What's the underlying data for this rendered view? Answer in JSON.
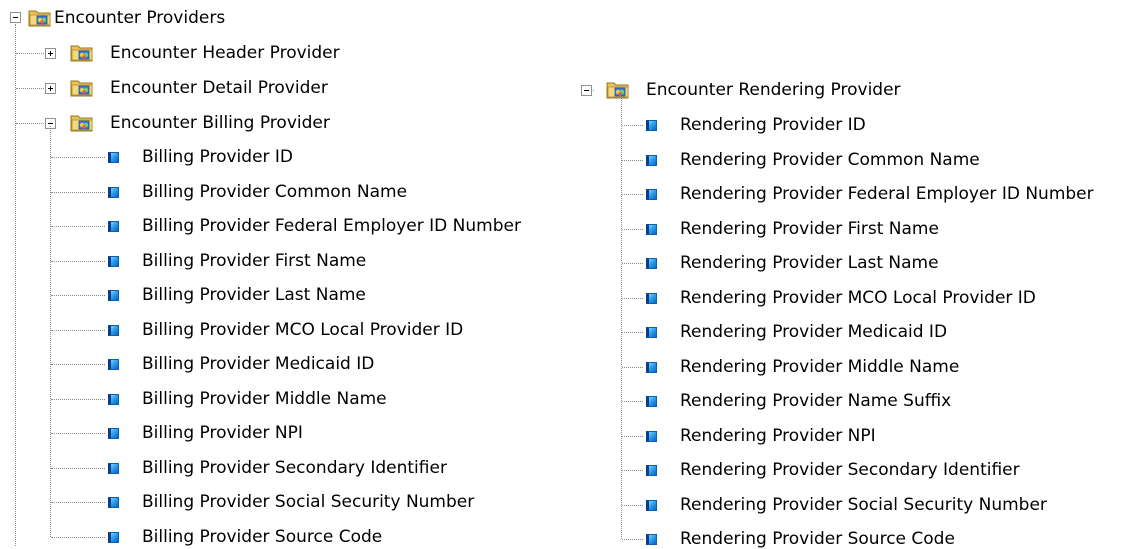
{
  "tree": {
    "root_label": "Encounter Providers",
    "left_nodes": [
      {
        "label": "Encounter Header Provider",
        "state": "collapsed"
      },
      {
        "label": "Encounter Detail Provider",
        "state": "collapsed"
      },
      {
        "label": "Encounter Billing Provider",
        "state": "expanded"
      }
    ],
    "billing_children": [
      "Billing Provider ID",
      "Billing Provider Common Name",
      "Billing Provider Federal Employer ID Number",
      "Billing Provider First Name",
      "Billing Provider Last Name",
      "Billing Provider MCO Local Provider ID",
      "Billing Provider Medicaid ID",
      "Billing Provider Middle Name",
      "Billing Provider NPI",
      "Billing Provider Secondary Identifier",
      "Billing Provider Social Security Number",
      "Billing Provider Source Code"
    ],
    "rendering_label": "Encounter Rendering  Provider",
    "rendering_children": [
      "Rendering Provider ID",
      "Rendering Provider Common Name",
      "Rendering Provider Federal Employer ID Number",
      "Rendering Provider First Name",
      "Rendering Provider Last Name",
      "Rendering Provider MCO Local Provider ID",
      "Rendering Provider Medicaid ID",
      "Rendering Provider Middle Name",
      "Rendering Provider Name Suffix",
      "Rendering Provider NPI",
      "Rendering Provider Secondary Identifier",
      "Rendering Provider Social Security Number",
      "Rendering Provider Source Code"
    ]
  }
}
